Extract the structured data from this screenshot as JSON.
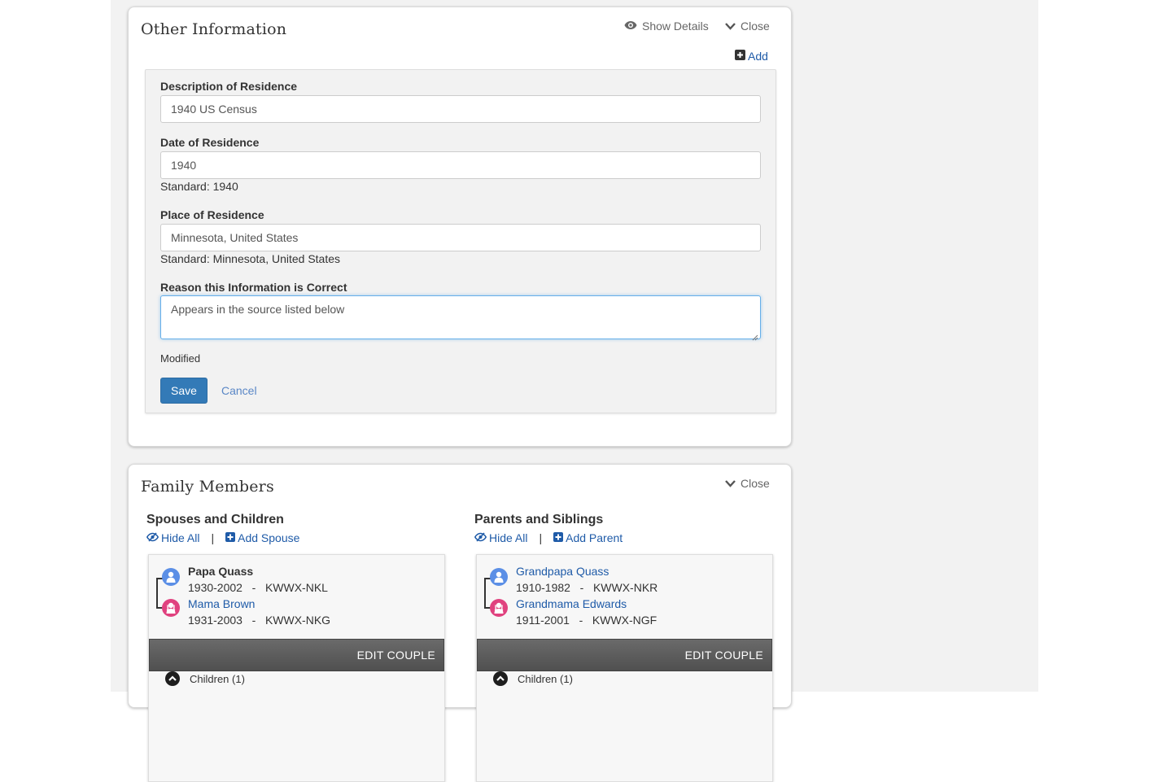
{
  "other_info": {
    "title": "Other Information",
    "show_details": "Show Details",
    "close": "Close",
    "add": "Add",
    "form": {
      "description_label": "Description of Residence",
      "description_value": "1940 US Census",
      "date_label": "Date of Residence",
      "date_value": "1940",
      "date_standard": "Standard: 1940",
      "place_label": "Place of Residence",
      "place_value": "Minnesota, United States",
      "place_standard": "Standard: Minnesota, United States",
      "reason_label": "Reason this Information is Correct",
      "reason_value": "Appears in the source listed below",
      "status": "Modified",
      "save": "Save",
      "cancel": "Cancel"
    }
  },
  "family": {
    "title": "Family Members",
    "close": "Close",
    "spouses": {
      "heading": "Spouses and Children",
      "hide_all": "Hide All",
      "separator": "|",
      "add": "Add Spouse",
      "couple": {
        "husband_name": "Papa Quass",
        "husband_info": "1930-2002   -   KWWX-NKL",
        "wife_name": "Mama Brown",
        "wife_info": "1931-2003   -   KWWX-NKG",
        "edit": "EDIT COUPLE",
        "children": "Children (1)"
      }
    },
    "parents": {
      "heading": "Parents and Siblings",
      "hide_all": "Hide All",
      "separator": "|",
      "add": "Add Parent",
      "couple": {
        "husband_name": "Grandpapa Quass",
        "husband_info": "1910-1982   -   KWWX-NKR",
        "wife_name": "Grandmama Edwards",
        "wife_info": "1911-2001   -   KWWX-NGF",
        "edit": "EDIT COUPLE",
        "children": "Children (1)"
      }
    }
  },
  "colors": {
    "link": "#1f5ba8",
    "primary_button": "#337ab7",
    "male": "#5b8fe6",
    "female": "#e0427f"
  }
}
